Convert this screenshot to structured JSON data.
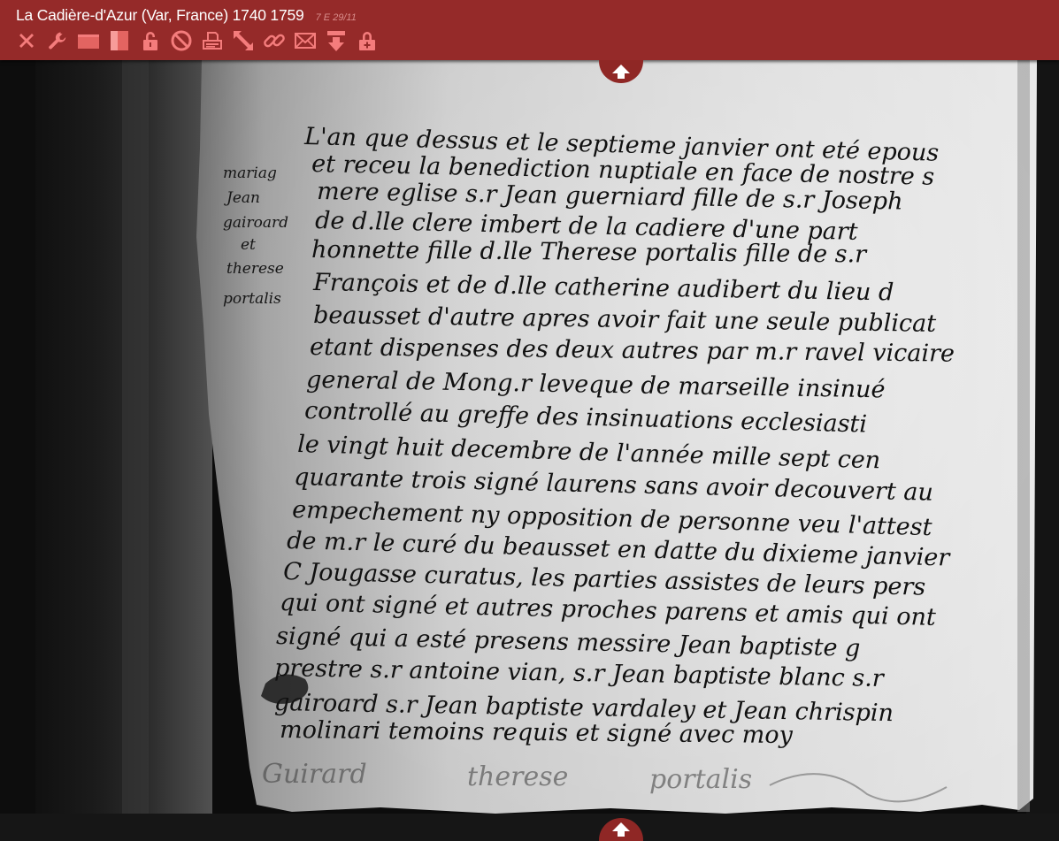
{
  "header": {
    "title": "La Cadière-d'Azur (Var, France) 1740 1759",
    "cote": "7 E 29/11"
  },
  "toolbar": {
    "buttons": [
      {
        "icon": "close-icon"
      },
      {
        "icon": "wrench-icon"
      },
      {
        "icon": "landscape-view-icon"
      },
      {
        "icon": "portrait-view-icon"
      },
      {
        "icon": "unlock-icon"
      },
      {
        "icon": "forbidden-icon"
      },
      {
        "icon": "print-icon"
      },
      {
        "icon": "resize-icon"
      },
      {
        "icon": "link-icon"
      },
      {
        "icon": "mail-icon"
      },
      {
        "icon": "download-icon"
      },
      {
        "icon": "lock-plus-icon"
      }
    ],
    "icon_color": "#f47c7c"
  },
  "colors": {
    "header_bg": "#952a29",
    "title_text": "#ffffff",
    "cote_text": "#d88c8a",
    "nav_tab_bg": "#8f2725"
  },
  "document": {
    "margin_note": [
      "mariag",
      "Jean",
      "gairoard",
      "et",
      "therese",
      "portalis"
    ],
    "body_lines": [
      "L'an que dessus et le septieme janvier ont eté epous",
      "et receu la benediction nuptiale en face de nostre s",
      "mere eglise s.r Jean guerniard fille de s.r Joseph",
      "de d.lle clere imbert de la cadiere d'une part",
      "honnette fille d.lle Therese portalis fille de s.r",
      "François et de d.lle catherine audibert du lieu d",
      "beausset d'autre apres avoir fait une seule publicat",
      "etant dispenses des deux autres par m.r ravel vicaire",
      "general de Mong.r leveque de marseille insinué",
      "controllé au greffe des insinuations ecclesiasti",
      "le vingt huit decembre de l'année mille sept cen",
      "quarante trois signé laurens sans avoir decouvert au",
      "empechement ny opposition de personne veu l'attest",
      "de m.r le curé du beausset en datte du dixieme janvier",
      "C Jougasse curatus, les parties assistes de leurs pers",
      "qui ont signé et autres proches parens et amis qui ont",
      "signé qui a esté presens messire Jean baptiste g",
      "prestre s.r antoine vian, s.r Jean baptiste blanc s.r",
      "gairoard s.r Jean baptiste vardaley et Jean chrispin",
      "molinari temoins requis et signé avec moy"
    ],
    "signatures": [
      "Guirard",
      "therese",
      "portalis"
    ]
  }
}
